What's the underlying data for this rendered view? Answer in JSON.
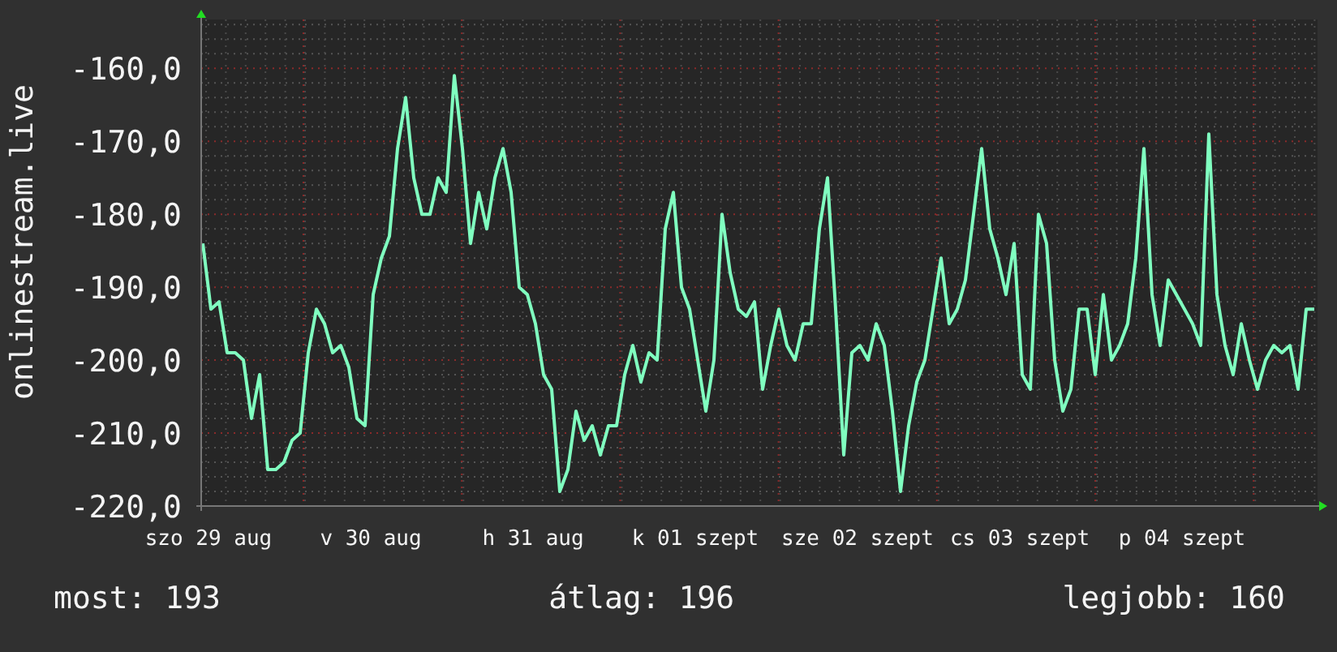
{
  "graph": {
    "chart_data": {
      "type": "line",
      "ylabel": "onlinestream.live",
      "grid": true,
      "ylim": [
        -220,
        -153.3
      ],
      "categories": [
        null,
        "szo 29 aug",
        null,
        null,
        null,
        null,
        null,
        null,
        null,
        null,
        null,
        null,
        null,
        null,
        null,
        null,
        null,
        null,
        null,
        null,
        null,
        "v 30 aug",
        null,
        null,
        null,
        null,
        null,
        null,
        null,
        null,
        null,
        null,
        null,
        null,
        null,
        null,
        null,
        null,
        null,
        null,
        null,
        "h 31 aug",
        null,
        null,
        null,
        null,
        null,
        null,
        null,
        null,
        null,
        null,
        null,
        null,
        null,
        null,
        null,
        null,
        null,
        null,
        null,
        "k 01 szept",
        null,
        null,
        null,
        null,
        null,
        null,
        null,
        null,
        null,
        null,
        null,
        null,
        null,
        null,
        null,
        null,
        null,
        null,
        null,
        "sze 02 szept",
        null,
        null,
        null,
        null,
        null,
        null,
        null,
        null,
        null,
        null,
        null,
        null,
        null,
        null,
        null,
        null,
        null,
        null,
        null,
        "cs 03 szept",
        null,
        null,
        null,
        null,
        null,
        null,
        null,
        null,
        null,
        null,
        null,
        null,
        null,
        null,
        null,
        null,
        null,
        null,
        null,
        "p 04 szept",
        null,
        null,
        null,
        null,
        null,
        null,
        null,
        null,
        null,
        null,
        null,
        null,
        null,
        null,
        null,
        null
      ],
      "yticks": [
        {
          "value": -160,
          "label": "-160,0"
        },
        {
          "value": -170,
          "label": "-170,0"
        },
        {
          "value": -180,
          "label": "-180,0"
        },
        {
          "value": -190,
          "label": "-190,0"
        },
        {
          "value": -200,
          "label": "-200,0"
        },
        {
          "value": -210,
          "label": "-210,0"
        },
        {
          "value": -220,
          "label": "-220,0"
        }
      ],
      "series": [
        {
          "color": "#80ffc0",
          "values": [
            -184,
            -193,
            -192,
            -199,
            -199,
            -200,
            -208,
            -202,
            -215,
            -215,
            -214,
            -211,
            -210,
            -199,
            -193,
            -195,
            -199,
            -198,
            -201,
            -208,
            -209,
            -191,
            -186,
            -183,
            -171,
            -164,
            -175,
            -180,
            -180,
            -175,
            -177,
            -161,
            -171,
            -184,
            -177,
            -182,
            -175,
            -171,
            -177,
            -190,
            -191,
            -195,
            -202,
            -204,
            -218,
            -215,
            -207,
            -211,
            -209,
            -213,
            -209,
            -209,
            -202,
            -198,
            -203,
            -199,
            -200,
            -182,
            -177,
            -190,
            -193,
            -200,
            -207,
            -200,
            -180,
            -188,
            -193,
            -194,
            -192,
            -204,
            -198,
            -193,
            -198,
            -200,
            -195,
            -195,
            -182,
            -175,
            -193,
            -213,
            -199,
            -198,
            -200,
            -195,
            -198,
            -207,
            -218,
            -209,
            -203,
            -200,
            -193,
            -186,
            -195,
            -193,
            -189,
            -180,
            -171,
            -182,
            -186,
            -191,
            -184,
            -202,
            -204,
            -180,
            -184,
            -200,
            -207,
            -204,
            -193,
            -193,
            -202,
            -191,
            -200,
            -198,
            -195,
            -186,
            -171,
            -191,
            -198,
            -189,
            -191,
            -193,
            -195,
            -198,
            -169,
            -191,
            -198,
            -202,
            -195,
            -200,
            -204,
            -200,
            -198,
            -199,
            -198,
            -204,
            -193,
            -193
          ]
        }
      ]
    }
  },
  "legend": [
    "most: 193",
    "átlag: 196",
    "legjobb: 160"
  ]
}
